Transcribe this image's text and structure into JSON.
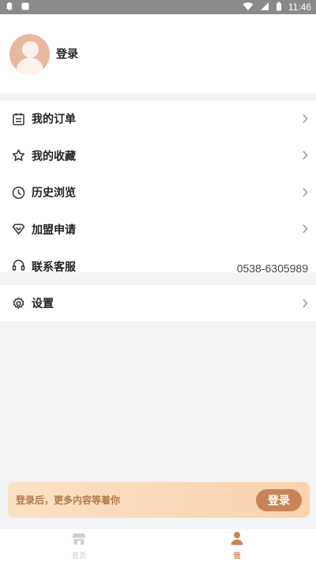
{
  "status_bar": {
    "time": "11:46"
  },
  "profile": {
    "login_text": "登录"
  },
  "menu": [
    {
      "label": "我的订单",
      "icon": "order-icon"
    },
    {
      "label": "我的收藏",
      "icon": "favorite-icon"
    },
    {
      "label": "历史浏览",
      "icon": "history-icon"
    },
    {
      "label": "加盟申请",
      "icon": "diamond-icon"
    },
    {
      "label": "联系客服",
      "icon": "headset-icon",
      "value": "0538-6305989"
    }
  ],
  "settings": {
    "label": "设置",
    "icon": "gear-icon"
  },
  "banner": {
    "text": "登录后，更多内容等着你",
    "button": "登录"
  },
  "bottom_nav": [
    {
      "label": "首页",
      "icon": "store-icon",
      "active": false
    },
    {
      "label": "我",
      "icon": "user-icon",
      "active": true
    }
  ],
  "colors": {
    "accent": "#c88457",
    "banner_start": "#fbe1c4",
    "banner_end": "#f9d3ad",
    "avatar": "#e8b89f",
    "background": "#f2f3f5"
  }
}
